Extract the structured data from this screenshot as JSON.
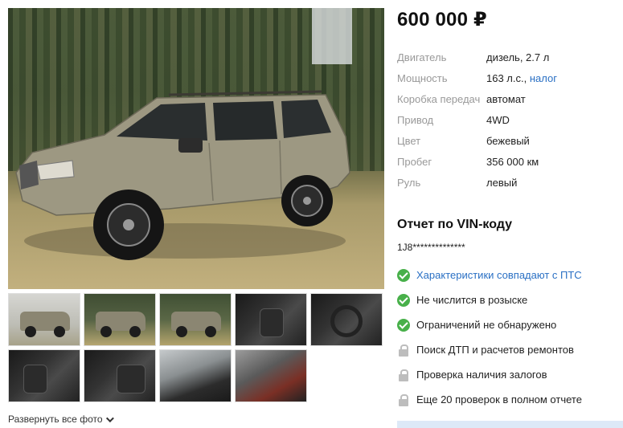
{
  "listing": {
    "price": "600 000 ₽",
    "specs": [
      {
        "label": "Двигатель",
        "value": "дизель, 2.7 л"
      },
      {
        "label": "Мощность",
        "value": "163 л.с.,",
        "link": "налог"
      },
      {
        "label": "Коробка передач",
        "value": "автомат"
      },
      {
        "label": "Привод",
        "value": "4WD"
      },
      {
        "label": "Цвет",
        "value": "бежевый"
      },
      {
        "label": "Пробег",
        "value": "356 000 км"
      },
      {
        "label": "Руль",
        "value": "левый"
      }
    ]
  },
  "vin": {
    "title": "Отчет по VIN-коду",
    "code": "1J8**************",
    "checks": [
      {
        "text": "Характеристики совпадают с ПТС",
        "status": "ok",
        "link": true
      },
      {
        "text": "Не числится в розыске",
        "status": "ok",
        "link": false
      },
      {
        "text": "Ограничений не обнаружено",
        "status": "ok",
        "link": false
      },
      {
        "text": "Поиск ДТП и расчетов ремонтов",
        "status": "locked",
        "link": false
      },
      {
        "text": "Проверка наличия залогов",
        "status": "locked",
        "link": false
      },
      {
        "text": "Еще 20 проверок в полном отчете",
        "status": "locked",
        "link": false
      }
    ]
  },
  "gallery": {
    "expand_label": "Развернуть все фото",
    "expand_icon": "chevron-down-icon"
  },
  "colors": {
    "link": "#2a70c4",
    "ok": "#48b04a",
    "lock": "#bdbdbd",
    "label": "#999999"
  }
}
